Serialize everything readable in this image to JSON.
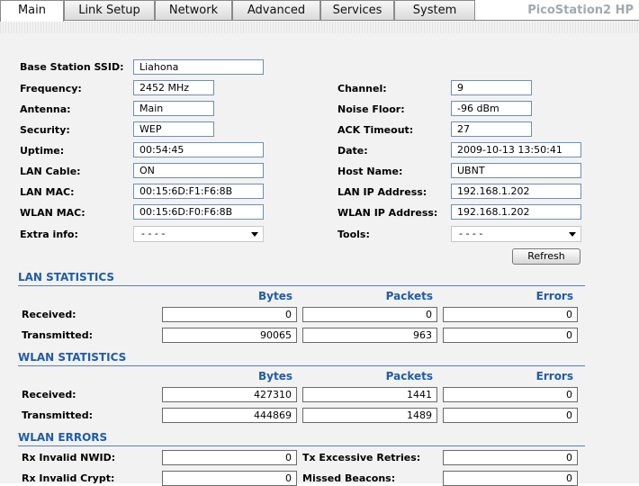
{
  "tabs": [
    {
      "label": "Main"
    },
    {
      "label": "Link Setup"
    },
    {
      "label": "Network"
    },
    {
      "label": "Advanced"
    },
    {
      "label": "Services"
    },
    {
      "label": "System"
    }
  ],
  "brand": "PicoStation2 HP",
  "status": {
    "ssid": {
      "label": "Base Station SSID:",
      "value": "Liahona"
    },
    "frequency": {
      "label": "Frequency:",
      "value": "2452 MHz"
    },
    "antenna": {
      "label": "Antenna:",
      "value": "Main"
    },
    "security": {
      "label": "Security:",
      "value": "WEP"
    },
    "uptime": {
      "label": "Uptime:",
      "value": "00:54:45"
    },
    "lan_cable": {
      "label": "LAN Cable:",
      "value": "ON"
    },
    "lan_mac": {
      "label": "LAN MAC:",
      "value": "00:15:6D:F1:F6:8B"
    },
    "wlan_mac": {
      "label": "WLAN MAC:",
      "value": "00:15:6D:F0:F6:8B"
    },
    "extra_info": {
      "label": "Extra info:",
      "value": "- - - -"
    },
    "channel": {
      "label": "Channel:",
      "value": "9"
    },
    "noise_floor": {
      "label": "Noise Floor:",
      "value": "-96 dBm"
    },
    "ack_timeout": {
      "label": "ACK Timeout:",
      "value": "27"
    },
    "date": {
      "label": "Date:",
      "value": "2009-10-13 13:50:41"
    },
    "host_name": {
      "label": "Host Name:",
      "value": "UBNT"
    },
    "lan_ip": {
      "label": "LAN IP Address:",
      "value": "192.168.1.202"
    },
    "wlan_ip": {
      "label": "WLAN IP Address:",
      "value": "192.168.1.202"
    },
    "tools": {
      "label": "Tools:",
      "value": "- - - -"
    },
    "refresh_label": "Refresh"
  },
  "lan_stats": {
    "title": "LAN STATISTICS",
    "columns": [
      "Bytes",
      "Packets",
      "Errors"
    ],
    "rows": [
      {
        "label": "Received:",
        "bytes": "0",
        "packets": "0",
        "errors": "0"
      },
      {
        "label": "Transmitted:",
        "bytes": "90065",
        "packets": "963",
        "errors": "0"
      }
    ]
  },
  "wlan_stats": {
    "title": "WLAN STATISTICS",
    "columns": [
      "Bytes",
      "Packets",
      "Errors"
    ],
    "rows": [
      {
        "label": "Received:",
        "bytes": "427310",
        "packets": "1441",
        "errors": "0"
      },
      {
        "label": "Transmitted:",
        "bytes": "444869",
        "packets": "1489",
        "errors": "0"
      }
    ]
  },
  "wlan_errors": {
    "title": "WLAN ERRORS",
    "rows": [
      {
        "left_label": "Rx Invalid NWID:",
        "left_value": "0",
        "right_label": "Tx Excessive Retries:",
        "right_value": "0"
      },
      {
        "left_label": "Rx Invalid Crypt:",
        "left_value": "0",
        "right_label": "Missed Beacons:",
        "right_value": "0"
      }
    ]
  }
}
